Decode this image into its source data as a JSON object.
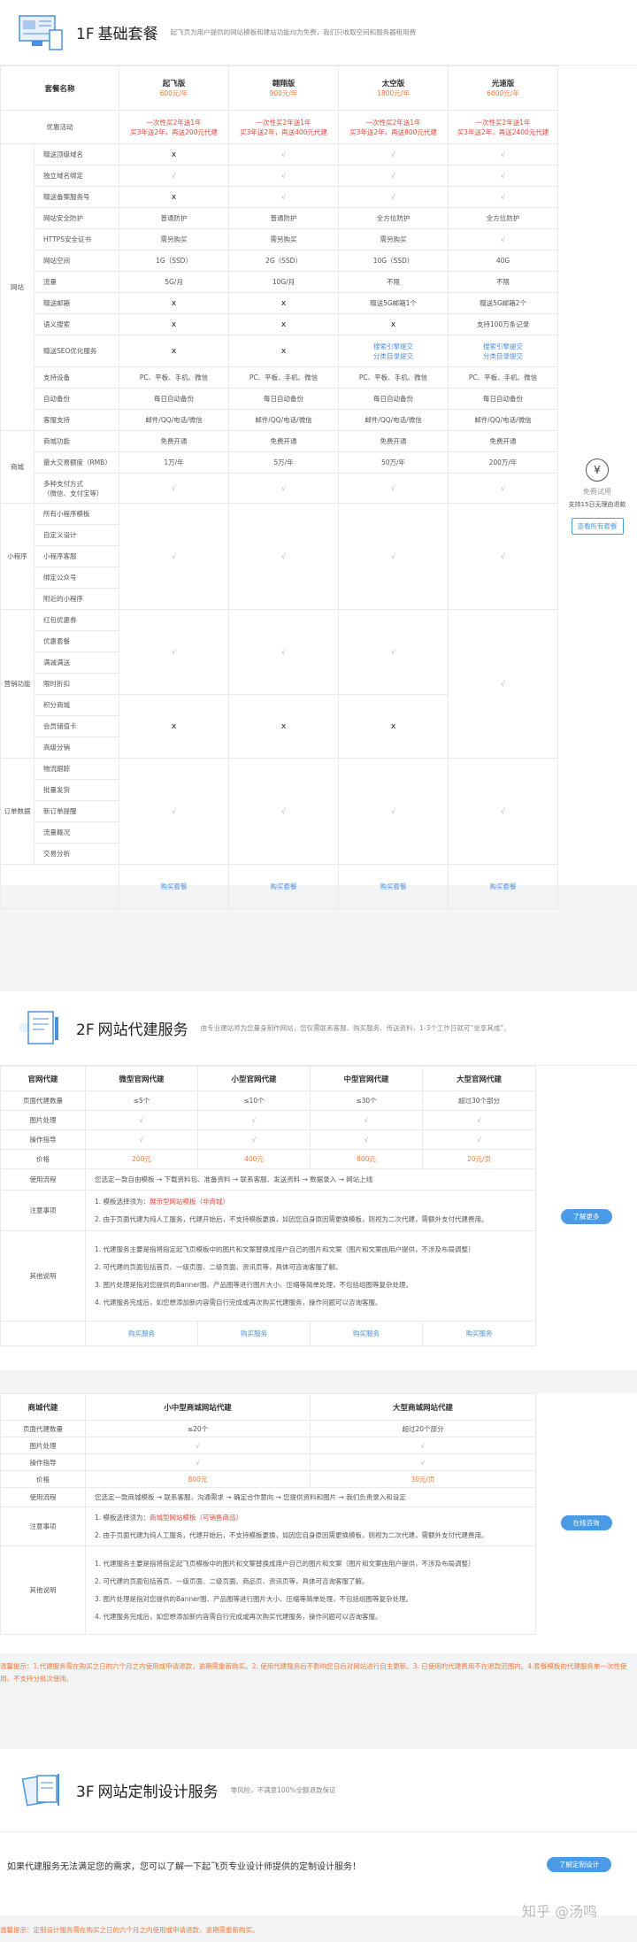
{
  "s1": {
    "num": "1F",
    "title": "基础套餐",
    "desc": "起飞页为用户提供的网站模板和建站功能均为免费，我们只收取空间和服务器租用费",
    "head_label": "套餐名称",
    "plans": [
      {
        "name": "起飞版",
        "price": "600元/年"
      },
      {
        "name": "翱翔版",
        "price": "900元/年"
      },
      {
        "name": "太空版",
        "price": "1800元/年"
      },
      {
        "name": "光速版",
        "price": "6000元/年"
      }
    ],
    "promo_label": "优惠活动",
    "promos": [
      [
        "一次性买2年送1年",
        "买3年送2年，再送200元代建"
      ],
      [
        "一次性买2年送1年",
        "买3年送2年，再送400元代建"
      ],
      [
        "一次性买2年送1年",
        "买3年送2年，再送800元代建"
      ],
      [
        "一次性买2年送1年",
        "买3年送2年，再送2400元代建"
      ]
    ],
    "groups": {
      "site": "网站",
      "mall": "商城",
      "mini": "小程序",
      "market": "营销功能",
      "order": "订单数据"
    },
    "site_rows": [
      {
        "label": "赠送顶级域名",
        "v": [
          "x",
          "√",
          "√",
          "√"
        ]
      },
      {
        "label": "独立域名绑定",
        "v": [
          "√",
          "√",
          "√",
          "√"
        ]
      },
      {
        "label": "赠送备案服务号",
        "v": [
          "x",
          "√",
          "√",
          "√"
        ]
      },
      {
        "label": "网站安全防护",
        "v": [
          "普通防护",
          "普通防护",
          "全方位防护",
          "全方位防护"
        ]
      },
      {
        "label": "HTTPS安全证书",
        "v": [
          "需另购买",
          "需另购买",
          "需另购买",
          "√"
        ]
      },
      {
        "label": "网站空间",
        "v": [
          "1G（SSD）",
          "2G（SSD）",
          "10G（SSD）",
          "40G"
        ]
      },
      {
        "label": "流量",
        "v": [
          "5G/月",
          "10G/月",
          "不限",
          "不限"
        ]
      },
      {
        "label": "赠送邮箱",
        "v": [
          "x",
          "x",
          "赠送5G邮箱1个",
          "赠送5G邮箱2个"
        ]
      },
      {
        "label": "语义搜索",
        "v": [
          "x",
          "x",
          "x",
          "支持100万条记录"
        ]
      },
      {
        "label": "赠送SEO优化服务",
        "v": [
          "x",
          "x",
          "搜索引擎提交|分类目录提交",
          "搜索引擎提交|分类目录提交"
        ]
      },
      {
        "label": "支持设备",
        "v": [
          "PC、平板、手机、微信",
          "PC、平板、手机、微信",
          "PC、平板、手机、微信",
          "PC、平板、手机、微信"
        ]
      },
      {
        "label": "自动备份",
        "v": [
          "每日自动备份",
          "每日自动备份",
          "每日自动备份",
          "每日自动备份"
        ]
      },
      {
        "label": "客服支持",
        "v": [
          "邮件/QQ/电话/微信",
          "邮件/QQ/电话/微信",
          "邮件/QQ/电话/微信",
          "邮件/QQ/电话/微信"
        ]
      }
    ],
    "mall_rows": [
      {
        "label": "商城功能",
        "v": [
          "免费开通",
          "免费开通",
          "免费开通",
          "免费开通"
        ]
      },
      {
        "label": "最大交易额度（RMB）",
        "v": [
          "1万/年",
          "5万/年",
          "50万/年",
          "200万/年"
        ]
      },
      {
        "label": "多种支付方式|（微信、支付宝等）",
        "v": [
          "√",
          "√",
          "√",
          "√"
        ]
      }
    ],
    "mini_rows": [
      "所有小程序模板",
      "自定义设计",
      "小程序客服",
      "绑定公众号",
      "附近的小程序"
    ],
    "market_rows": [
      "红包优惠券",
      "优惠套餐",
      "满减满送",
      "限时折扣",
      "积分商城",
      "会员储值卡",
      "高级分销"
    ],
    "order_rows": [
      "物流跟踪",
      "批量发货",
      "新订单提醒",
      "流量概况",
      "交易分析"
    ],
    "check": "√",
    "cross": "x",
    "buy": "购买套餐",
    "trial": {
      "label": "免费试用",
      "sub": "支持15日无理由退款",
      "btn": "查看所有套餐"
    }
  },
  "s2": {
    "num": "2F",
    "title": "网站代建服务",
    "desc": "由专业建站师为您量身制作网站，您仅需联系客服、购买服务、传送资料，1-3个工作日就可“坐享其成”。",
    "head_label": "官网代建",
    "cols": [
      "微型官网代建",
      "小型官网代建",
      "中型官网代建",
      "大型官网代建"
    ],
    "rows": [
      {
        "label": "页面代建数量",
        "v": [
          "≤5个",
          "≤10个",
          "≤30个",
          "超过30个部分"
        ]
      },
      {
        "label": "图片处理",
        "v": [
          "√",
          "√",
          "√",
          "√"
        ]
      },
      {
        "label": "操作指导",
        "v": [
          "√",
          "√",
          "√",
          "√"
        ]
      }
    ],
    "price_label": "价格",
    "prices": [
      "200元",
      "400元",
      "800元",
      "20元/页"
    ],
    "flow_label": "使用流程",
    "flow": "您选定一款自由模板 → 下载资料包、准备资料 → 联系客服、发送资料 → 数据录入 → 网站上线",
    "attn_label": "注意事项",
    "attn": [
      "1. 模板选择须为：展示型网站模板（非商城）",
      "2. 由于页面代建为纯人工服务，代建开始后，不支持模板更换，如因您自身原因需更换模板，则视为二次代建，需额外支付代建费用。"
    ],
    "other_label": "其他说明",
    "other": [
      "1. 代建服务主要是指将指定起飞页模板中的图片和文案替换成用户自己的图片和文案（图片和文案由用户提供，不涉及布局调整）",
      "2. 可代建的页面包括首页、一级页面、二级页面、资讯页等，具体可咨询客服了解。",
      "3. 图片处理是指对您提供的Banner图、产品图等进行图片大小、压缩等简单处理，不包括组图等复杂处理。",
      "4. 代建服务完成后，如您想添加新内容需自行完成或再次购买代建服务，操作问题可以咨询客服。"
    ],
    "buy": "购买服务",
    "side_btn": "了解更多",
    "mall_head": "商城代建",
    "mall_cols": [
      "小中型商城网站代建",
      "大型商城网站代建"
    ],
    "mall_rows": [
      {
        "label": "页面代建数量",
        "v": [
          "≤20个",
          "超过20个部分"
        ]
      },
      {
        "label": "图片处理",
        "v": [
          "√",
          "√"
        ]
      },
      {
        "label": "操作指导",
        "v": [
          "√",
          "√"
        ]
      }
    ],
    "mall_prices": [
      "800元",
      "30元/页"
    ],
    "mall_flow": "您选定一款商城模板 → 联系客服，沟通需求 → 确定合作意向 → 您提供资料和图片 → 我们负责录入和设定",
    "mall_attn": [
      "1. 模板选择须为：商城型网站模板（可销售商品）",
      "2. 由于页面代建为纯人工服务，代建开始后，不支持模板更换，如因您自身原因需更换模板，则视为二次代建，需额外支付代建费用。"
    ],
    "mall_other": [
      "1. 代建服务主要是指将指定起飞页模板中的图片和文案替换成用户自己的图片和文案（图片和文案由用户提供，不涉及布局调整）",
      "2. 可代建的页面包括首页、一级页面、二级页面、商品页、资讯页等，具体可咨询客服了解。",
      "3. 图片处理是指对您提供的Banner图、产品图等进行图片大小、压缩等简单处理，不包括组图等复杂处理。",
      "4. 代建服务完成后，如您想添加新内容需自行完成或再次购买代建服务，操作问题可以咨询客服。"
    ],
    "mall_side_btn": "在线咨询",
    "warning": "温馨提示：1.代建服务需在购买之日的六个月之内使用或申请退款，逾期需重新购买。2. 使用代建服务后不影响您日后对网站进行自主更新。3. 已使用的代建费用不在退款范围内。4.套餐模板的代建服务单一次性使用，不支持分批次使用。"
  },
  "s3": {
    "num": "3F",
    "title": "网站定制设计服务",
    "desc": "零风险，不满意100%全额退款保证",
    "text": "如果代建服务无法满足您的需求，您可以了解一下起飞页专业设计师提供的定制设计服务！",
    "btn": "了解定制设计",
    "warning": "温馨提示：定制设计服务需在购买之日的六个月之内使用或申请退款，逾期需重新购买。",
    "watermark": "知乎 @汤鸣"
  }
}
